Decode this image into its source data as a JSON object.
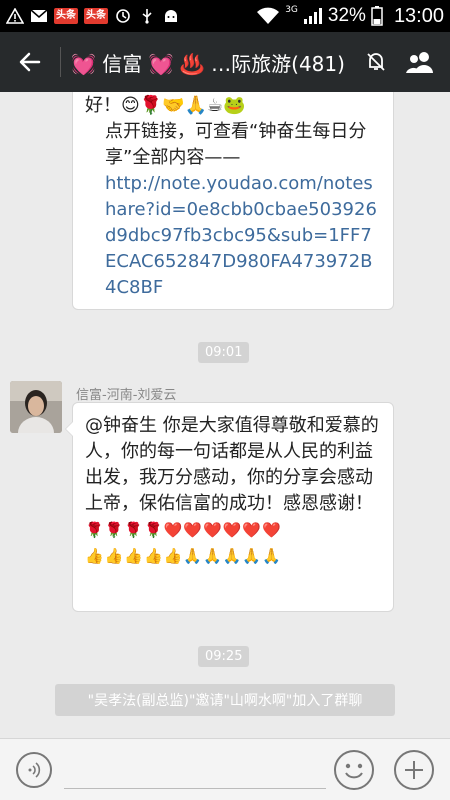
{
  "status_bar": {
    "badge_1": "头条",
    "badge_2": "头条",
    "network": "3G",
    "battery": "32%",
    "time": "13:00"
  },
  "title_bar": {
    "title": "💓 信富 💓 ♨️ …际旅游(481)"
  },
  "messages": {
    "msg1": {
      "line_greeting": "好！😊🌹🤝🙏☕🐸",
      "line_instruction": "点开链接，可查看“钟奋生每日分享”全部内容——",
      "link": "http://note.youdao.com/noteshare?id=0e8cbb0cbae503926d9dbc97fb3cbc95&sub=1FF7ECAC652847D980FA473972B4C8BF"
    },
    "time_1": "09:01",
    "msg2": {
      "sender": "信富-河南-刘爱云",
      "text": "@钟奋生 你是大家值得尊敬和爱慕的人，你的每一句话都是从人民的利益出发，我万分感动，你的分享会感动上帝，保佑信富的成功！感恩感谢！",
      "emoji_row1": "🌹🌹🌹🌹❤️❤️❤️❤️❤️❤️",
      "emoji_row2": "👍👍👍👍👍🙏🙏🙏🙏🙏"
    },
    "time_2": "09:25",
    "system": "\"吴孝法(副总监)\"邀请\"山啊水啊\"加入了群聊"
  },
  "input_bar": {
    "placeholder": ""
  },
  "colors": {
    "title_bg": "#272a2c",
    "chat_bg": "#ebebeb",
    "link": "#3e6b9c",
    "pill_bg": "#d3d3d3"
  }
}
